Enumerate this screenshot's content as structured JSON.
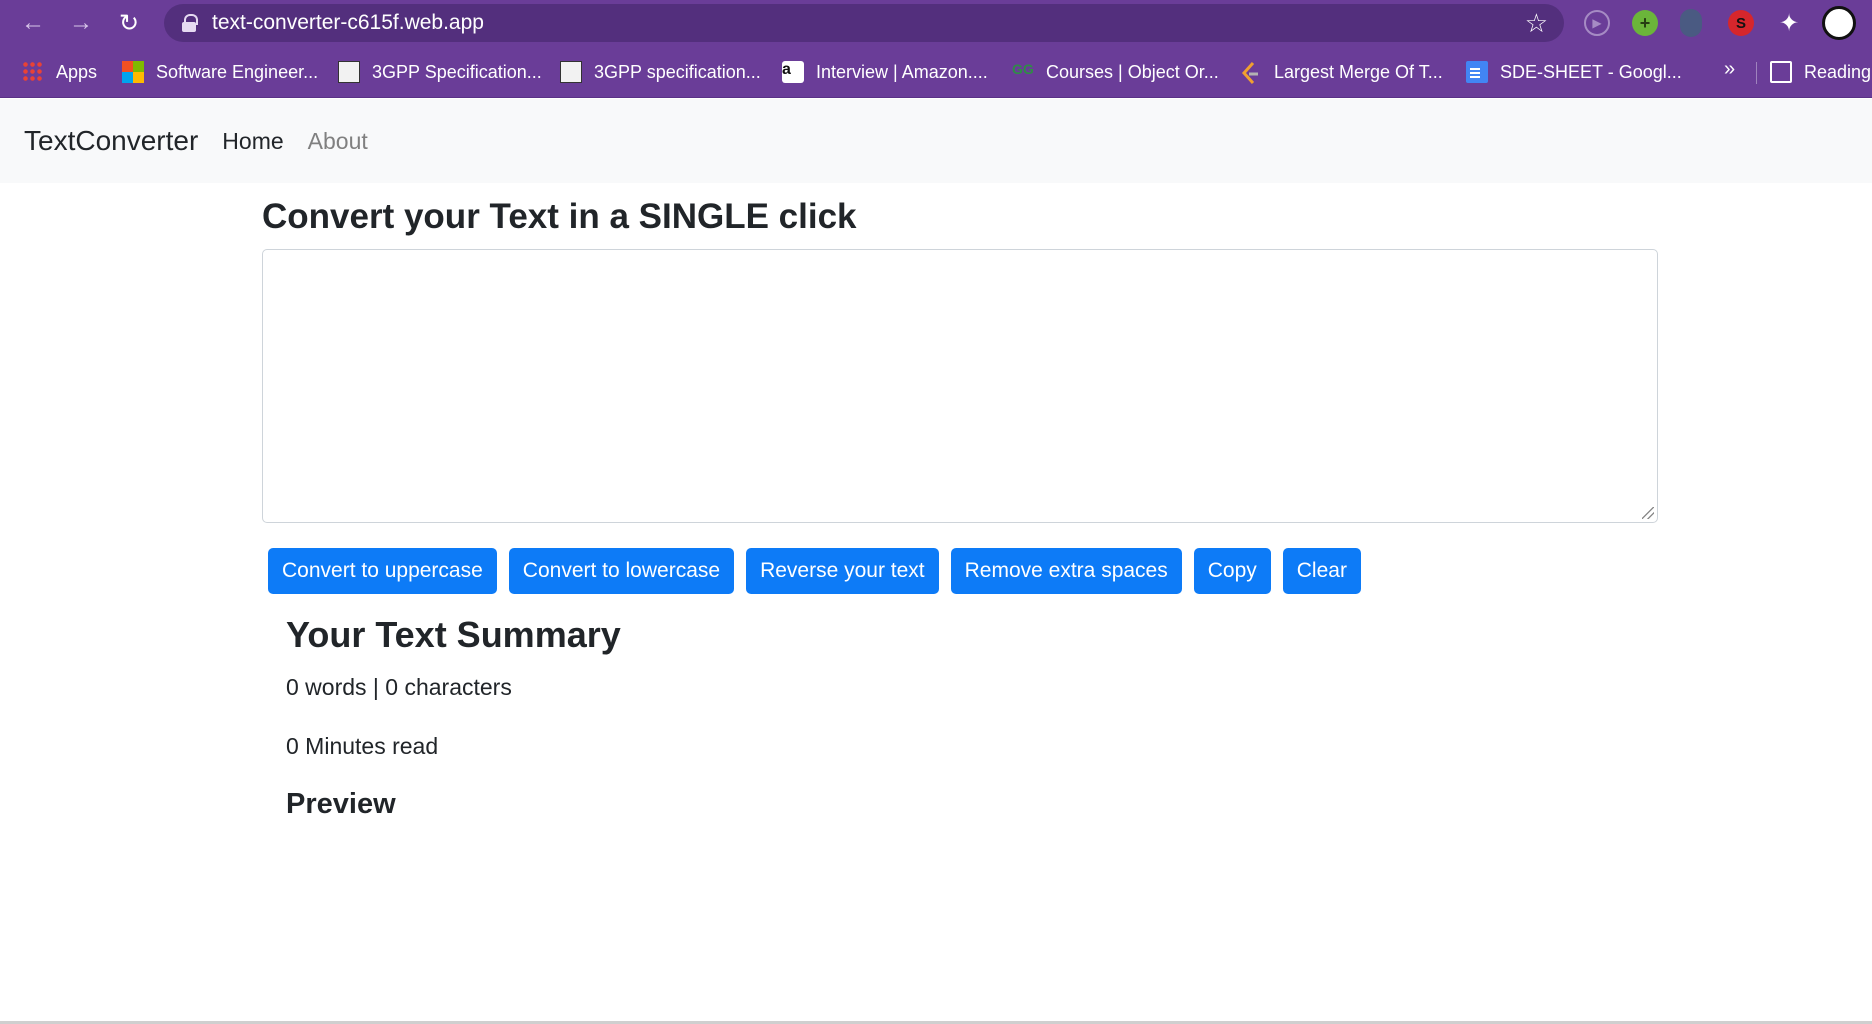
{
  "browser": {
    "url": "text-converter-c615f.web.app",
    "bookmarks": [
      {
        "label": "Apps",
        "icon": "apps-grid-icon"
      },
      {
        "label": "Software Engineer...",
        "icon": "microsoft-icon"
      },
      {
        "label": "3GPP Specification...",
        "icon": "3gpp-icon"
      },
      {
        "label": "3GPP specification...",
        "icon": "3gpp-icon"
      },
      {
        "label": "Interview | Amazon....",
        "icon": "amazon-icon"
      },
      {
        "label": "Courses | Object Or...",
        "icon": "geeksforgeeks-icon"
      },
      {
        "label": "Largest Merge Of T...",
        "icon": "leetcode-icon"
      },
      {
        "label": "SDE-SHEET - Googl...",
        "icon": "google-docs-icon"
      }
    ],
    "more_label": "»",
    "reading_list_label": "Reading"
  },
  "navbar": {
    "brand": "TextConverter",
    "links": [
      "Home",
      "About"
    ]
  },
  "main": {
    "heading": "Convert your Text in a SINGLE click",
    "textarea_value": "",
    "buttons": [
      "Convert to uppercase",
      "Convert to lowercase",
      "Reverse your text",
      "Remove extra spaces",
      "Copy",
      "Clear"
    ],
    "button_color": "#0d7bf7"
  },
  "summary": {
    "title": "Your Text Summary",
    "counts": "0 words | 0 characters",
    "read_time": "0 Minutes read",
    "preview_title": "Preview"
  }
}
